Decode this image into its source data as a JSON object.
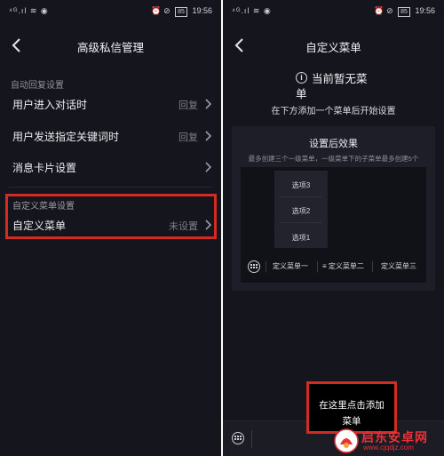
{
  "left": {
    "status": {
      "signal": "⁴ᴳ.ıl ≋ ◉",
      "icons": "⏰ ⊘",
      "battery": "85",
      "time": "19:56"
    },
    "title": "高级私信管理",
    "auto_reply_section": "自动回复设置",
    "rows": [
      {
        "label": "用户进入对话时",
        "value": "回复"
      },
      {
        "label": "用户发送指定关键词时",
        "value": "回复"
      },
      {
        "label": "消息卡片设置",
        "value": ""
      }
    ],
    "custom_menu_section": "自定义菜单设置",
    "custom_menu_row": {
      "label": "自定义菜单",
      "value": "未设置"
    }
  },
  "right": {
    "status": {
      "signal": "⁴ᴳ.ıl ≋ ◉",
      "icons": "⏰ ⊘",
      "battery": "85",
      "time": "19:56"
    },
    "title": "自定义菜单",
    "empty_title_line1": "当前暂无菜",
    "empty_title_line2": "单",
    "empty_desc": "在下方添加一个菜单后开始设置",
    "preview": {
      "title": "设置后效果",
      "note": "最多创建三个一级菜单，一级菜单下的子菜单最多创建5个",
      "submenu": [
        "选项3",
        "选项2",
        "选项1"
      ],
      "menus": [
        "定义菜单一",
        "≡ 定义菜单二",
        "定义菜单三"
      ]
    },
    "add_button": "在这里点击添加",
    "add_button_overflow": "菜单"
  },
  "watermark": {
    "name": "启东安卓网",
    "url": "www.cjqdjz.com"
  },
  "colors": {
    "background": "#15161d",
    "highlight": "#d12b24",
    "card": "#1d1e27",
    "watermark": "#e8323a"
  }
}
